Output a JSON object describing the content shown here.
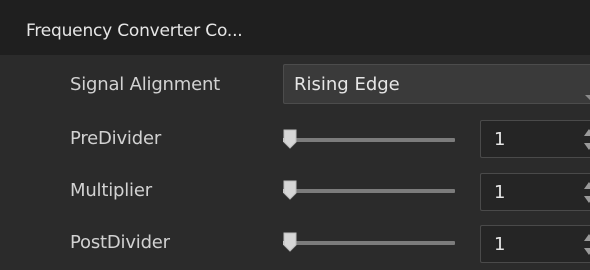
{
  "panel": {
    "title": "Frequency Converter Co..."
  },
  "signal_alignment": {
    "label": "Signal Alignment",
    "value": "Rising Edge"
  },
  "pre_divider": {
    "label": "PreDivider",
    "value": "1",
    "slider_fraction": 0.0
  },
  "multiplier": {
    "label": "Multiplier",
    "value": "1",
    "slider_fraction": 0.0
  },
  "post_divider": {
    "label": "PostDivider",
    "value": "1",
    "slider_fraction": 0.0
  },
  "colors": {
    "background": "#2b2b2b",
    "header": "#1f1f1f",
    "text": "#d2d2d2",
    "slider_track": "#7c7c7c",
    "slider_thumb": "#d6d6d6"
  },
  "icons": {
    "dropdown": "chevron-down-icon",
    "spin_up": "arrow-up-icon",
    "spin_down": "arrow-down-icon",
    "slider_thumb": "slider-thumb-icon"
  }
}
